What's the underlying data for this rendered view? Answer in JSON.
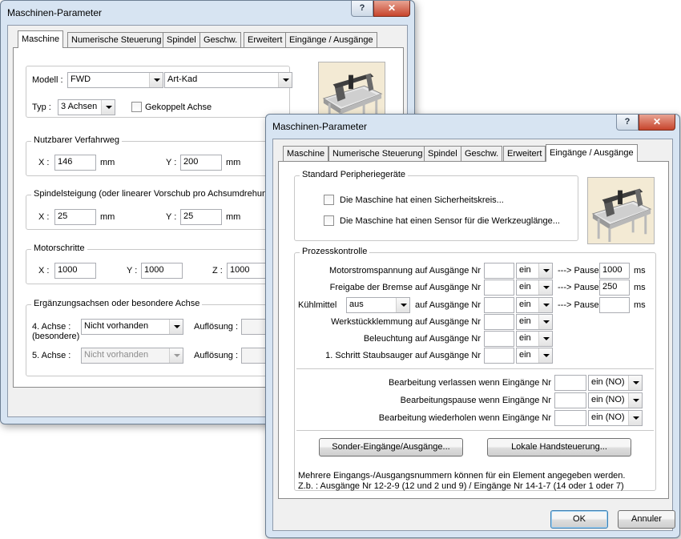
{
  "colors": {
    "frame": "#d7e4f2",
    "close": "#c7452c",
    "client": "#f0f0f0"
  },
  "back": {
    "title": "Maschinen-Parameter",
    "help": "?",
    "close": "✕",
    "tabs": [
      "Maschine",
      "Numerische Steuerung",
      "Spindel",
      "Geschw.",
      "Erweitert",
      "Eingänge / Ausgänge"
    ],
    "modell_label": "Modell :",
    "modell_value": "FWD",
    "modell_value2": "Art-Kad",
    "typ_label": "Typ :",
    "typ_value": "3 Achsen",
    "gekoppelt": "Gekoppelt Achse",
    "verfahr_title": "Nutzbarer Verfahrweg",
    "x_label": "X :",
    "y_label": "Y :",
    "z_label": "Z :",
    "unit_mm": "mm",
    "verfahr_x": "146",
    "verfahr_y": "200",
    "spindel_title": "Spindelsteigung (oder linearer Vorschub pro Achsumdrehung)",
    "spindel_x": "25",
    "spindel_y": "25",
    "motor_title": "Motorschritte",
    "motor_x": "1000",
    "motor_y": "1000",
    "motor_z": "1000",
    "ergaenz_title": "Ergänzungsachsen oder besondere Achse",
    "achse4_label": "4. Achse :",
    "achse4_sub": "(besondere)",
    "achse4_value": "Nicht vorhanden",
    "achse5_label": "5. Achse :",
    "achse5_value": "Nicht vorhanden",
    "aufloesung": "Auflösung :"
  },
  "front": {
    "title": "Maschinen-Parameter",
    "help": "?",
    "close": "✕",
    "tabs": [
      "Maschine",
      "Numerische Steuerung",
      "Spindel",
      "Geschw.",
      "Erweitert",
      "Eingänge / Ausgänge"
    ],
    "std_title": "Standard Peripheriegeräte",
    "sicherheit": "Die Maschine hat einen Sicherheitskreis...",
    "sensor": "Die Maschine hat einen Sensor für die Werkzeuglänge...",
    "prozess_title": "Prozesskontrolle",
    "rows": [
      {
        "label": "Motorstromspannung auf Ausgänge Nr",
        "nr": "",
        "mode": "ein",
        "pause_label": "---> Pause",
        "pause": "1000",
        "unit": "ms"
      },
      {
        "label": "Freigabe der Bremse auf Ausgänge Nr",
        "nr": "",
        "mode": "ein",
        "pause_label": "---> Pause",
        "pause": "250",
        "unit": "ms"
      },
      {
        "label": "auf Ausgänge Nr",
        "nr": "",
        "mode": "ein",
        "pause_label": "---> Pause",
        "pause": "",
        "unit": "ms"
      },
      {
        "label": "Werkstückklemmung auf Ausgänge Nr",
        "nr": "",
        "mode": "ein"
      },
      {
        "label": "Beleuchtung auf Ausgänge Nr",
        "nr": "",
        "mode": "ein"
      },
      {
        "label": "1. Schritt Staubsauger auf Ausgänge Nr",
        "nr": "",
        "mode": "ein"
      }
    ],
    "kuehlmittel_label": "Kühlmittel",
    "kuehlmittel_value": "aus",
    "inputs": [
      {
        "label": "Bearbeitung verlassen wenn Eingänge Nr",
        "nr": "",
        "mode": "ein (NO)"
      },
      {
        "label": "Bearbeitungspause wenn Eingänge Nr",
        "nr": "",
        "mode": "ein (NO)"
      },
      {
        "label": "Bearbeitung wiederholen wenn Eingänge Nr",
        "nr": "",
        "mode": "ein (NO)"
      }
    ],
    "sonder_btn": "Sonder-Eingänge/Ausgänge...",
    "hand_btn": "Lokale Handsteuerung...",
    "note1": "Mehrere Eingangs-/Ausgangsnummern können für ein Element angegeben werden.",
    "note2": "Z.b. :  Ausgänge Nr 12-2-9  (12 und 2 und 9)   /   Eingänge Nr 14-1-7  (14 oder 1 oder 7)",
    "ok": "OK",
    "cancel": "Annuler"
  }
}
